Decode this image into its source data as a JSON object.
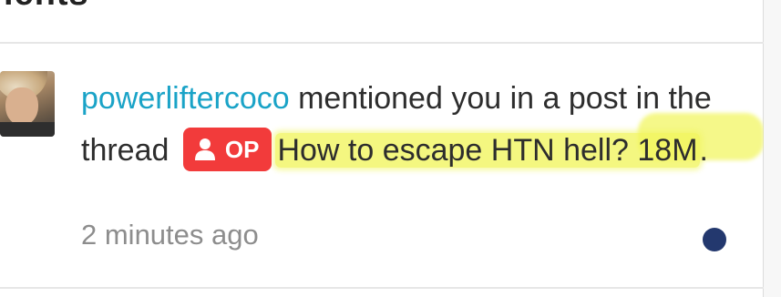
{
  "header": {
    "title_fragment": "ients"
  },
  "notification": {
    "username": "powerliftercoco",
    "text_before": " mentioned you in a post in the thread ",
    "badge": {
      "label": "OP",
      "icon": "user-icon",
      "color": "#f23b3b"
    },
    "thread_title": "How to escape HTN hell? 18M",
    "text_after": ".",
    "timestamp": "2 minutes ago",
    "unread": true,
    "accent_color": "#1aa3c7",
    "highlight_color": "#f1f55c",
    "dot_color": "#23386e"
  }
}
